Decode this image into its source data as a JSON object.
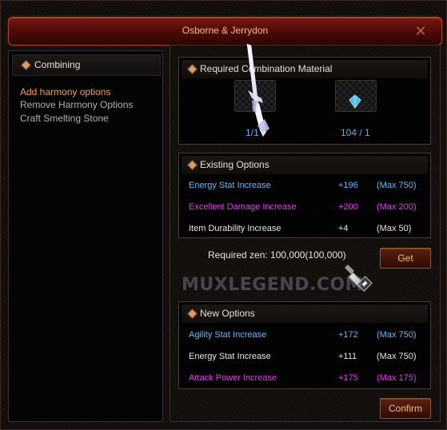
{
  "window": {
    "title": "Osborne & Jerrydon",
    "close_icon": "close-x-icon"
  },
  "left": {
    "header": "Combining",
    "menu": [
      {
        "label": "Add harmony options",
        "active": true
      },
      {
        "label": "Remove Harmony Options",
        "active": false
      },
      {
        "label": "Craft Smelting Stone",
        "active": false
      }
    ]
  },
  "materials": {
    "header": "Required Combination Material",
    "items": [
      {
        "icon": "sword-icon",
        "count": "1/1"
      },
      {
        "icon": "blue-gem-icon",
        "count": "104 / 1"
      }
    ]
  },
  "existing": {
    "header": "Existing Options",
    "rows": [
      {
        "name": "Energy Stat Increase",
        "value": "+196",
        "max": "(Max 750)",
        "color": "#6ab4f0"
      },
      {
        "name": "Excellent Damage Increase",
        "value": "+200",
        "max": "(Max 200)",
        "color": "#e03ce8"
      },
      {
        "name": "Item Durability Increase",
        "value": "+4",
        "max": "(Max 50)",
        "color": "#e8e4dc"
      }
    ]
  },
  "zen": {
    "label": "Required zen: 100,000(100,000)",
    "get_label": "Get"
  },
  "watermark": "MUXLEGEND.COM",
  "new_options": {
    "header": "New Options",
    "rows": [
      {
        "name": "Agility Stat Increase",
        "value": "+172",
        "max": "(Max 750)",
        "color": "#6ab4f0"
      },
      {
        "name": "Energy Stat Increase",
        "value": "+111",
        "max": "(Max 750)",
        "color": "#e8e4dc"
      },
      {
        "name": "Attack Power Increase",
        "value": "+175",
        "max": "(Max 175)",
        "color": "#e03ce8"
      }
    ]
  },
  "confirm_label": "Confirm"
}
